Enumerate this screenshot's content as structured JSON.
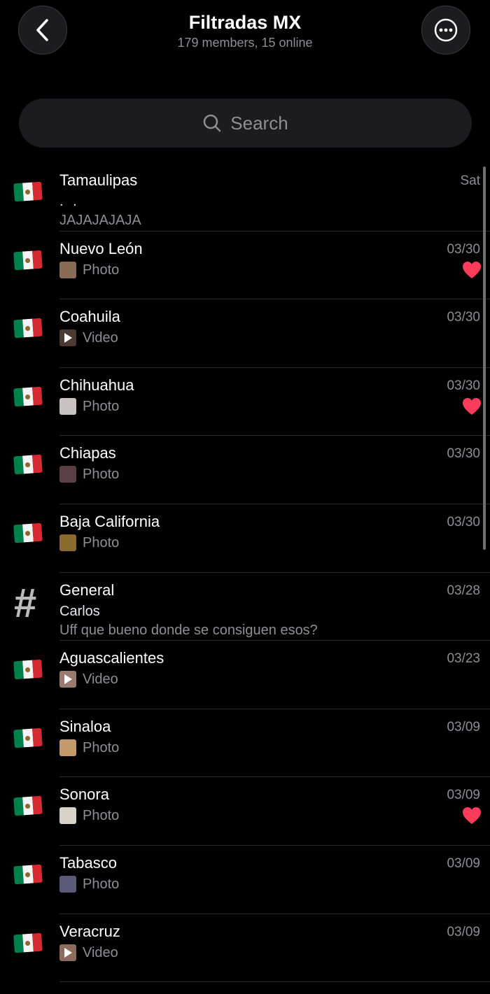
{
  "header": {
    "title": "Filtradas MX",
    "subtitle": "179 members, 15 online"
  },
  "search": {
    "placeholder": "Search"
  },
  "colors": {
    "background": "#000000",
    "heart": "#ff3b5c",
    "muted": "#8e8e93"
  },
  "chats": [
    {
      "icon": "mexico-flag-icon",
      "name": "Tamaulipas",
      "date": "Sat",
      "line2": ". .",
      "line3": "JAJAJAJAJA",
      "liked": false
    },
    {
      "icon": "mexico-flag-icon",
      "name": "Nuevo León",
      "date": "03/30",
      "media": "Photo",
      "thumb": "#8a6b55",
      "liked": true
    },
    {
      "icon": "mexico-flag-icon",
      "name": "Coahuila",
      "date": "03/30",
      "media": "Video",
      "thumb": "#4a3a32",
      "liked": false
    },
    {
      "icon": "mexico-flag-icon",
      "name": "Chihuahua",
      "date": "03/30",
      "media": "Photo",
      "thumb": "#c9c4c2",
      "liked": true
    },
    {
      "icon": "mexico-flag-icon",
      "name": "Chiapas",
      "date": "03/30",
      "media": "Photo",
      "thumb": "#5a3f45",
      "liked": false
    },
    {
      "icon": "mexico-flag-icon",
      "name": "Baja California",
      "date": "03/30",
      "media": "Photo",
      "thumb": "#8a6a2e",
      "liked": false
    },
    {
      "icon": "hash-icon",
      "name": "General",
      "date": "03/28",
      "line2": "Carlos",
      "line3": "Uff que bueno donde se consiguen esos?",
      "liked": false
    },
    {
      "icon": "mexico-flag-icon",
      "name": "Aguascalientes",
      "date": "03/23",
      "media": "Video",
      "thumb": "#9a7b70",
      "liked": false
    },
    {
      "icon": "mexico-flag-icon",
      "name": "Sinaloa",
      "date": "03/09",
      "media": "Photo",
      "thumb": "#c29a6b",
      "liked": false
    },
    {
      "icon": "mexico-flag-icon",
      "name": "Sonora",
      "date": "03/09",
      "media": "Photo",
      "thumb": "#d9d2c8",
      "liked": true
    },
    {
      "icon": "mexico-flag-icon",
      "name": "Tabasco",
      "date": "03/09",
      "media": "Photo",
      "thumb": "#5b5a78",
      "liked": false
    },
    {
      "icon": "mexico-flag-icon",
      "name": "Veracruz",
      "date": "03/09",
      "media": "Video",
      "thumb": "#8c6c5c",
      "liked": false
    }
  ]
}
